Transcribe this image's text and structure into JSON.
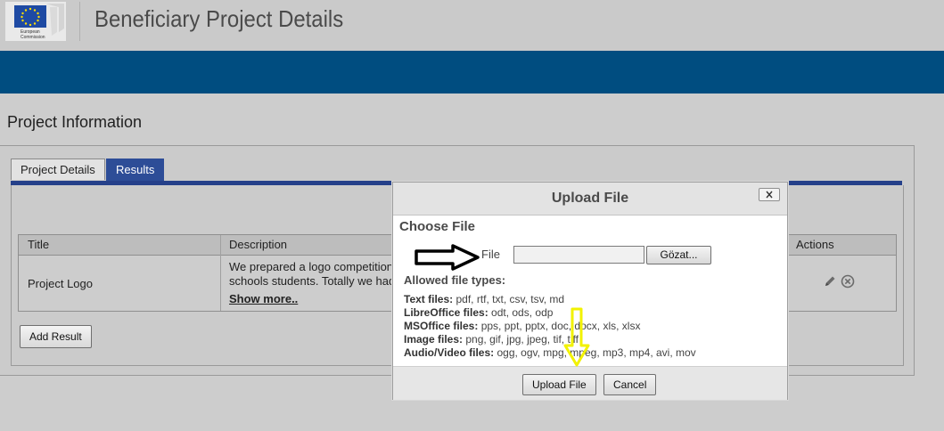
{
  "header": {
    "logo_text_line1": "European",
    "logo_text_line2": "Commission",
    "title": "Beneficiary Project Details"
  },
  "page": {
    "section_title": "Project Information"
  },
  "tabs": [
    {
      "label": "Project Details",
      "active": false
    },
    {
      "label": "Results",
      "active": true
    }
  ],
  "results_table": {
    "columns": [
      "Title",
      "Description",
      "Actions"
    ],
    "rows": [
      {
        "title": "Project Logo",
        "description_line1": "We prepared a logo competition",
        "description_line2": "schools students. Totally we had",
        "show_more": "Show more.."
      }
    ],
    "row_action_icons": [
      "pencil-icon",
      "remove-circle-icon"
    ]
  },
  "buttons": {
    "add_result": "Add Result"
  },
  "dialog": {
    "title": "Upload File",
    "close_glyph": "×",
    "section_title": "Choose File",
    "file_label": "File",
    "browse_label": "Gözat...",
    "allowed_title": "Allowed file types:",
    "file_types": [
      {
        "label": "Text files:",
        "exts": "pdf, rtf, txt, csv, tsv, md"
      },
      {
        "label": "LibreOffice files:",
        "exts": "odt, ods, odp"
      },
      {
        "label": "MSOffice files:",
        "exts": "pps, ppt, pptx, doc, docx, xls, xlsx"
      },
      {
        "label": "Image files:",
        "exts": "png, gif, jpg, jpeg, tif, tiff"
      },
      {
        "label": "Audio/Video files:",
        "exts": "ogg, ogv, mpg, mpeg, mp3, mp4, avi, mov"
      }
    ],
    "upload_label": "Upload File",
    "cancel_label": "Cancel"
  },
  "annotations": {
    "black_arrow_color": "#000000",
    "yellow_arrow_color": "#f2f200"
  },
  "colors": {
    "brand_bar": "#004d80",
    "active_tab": "#2d4d97"
  }
}
